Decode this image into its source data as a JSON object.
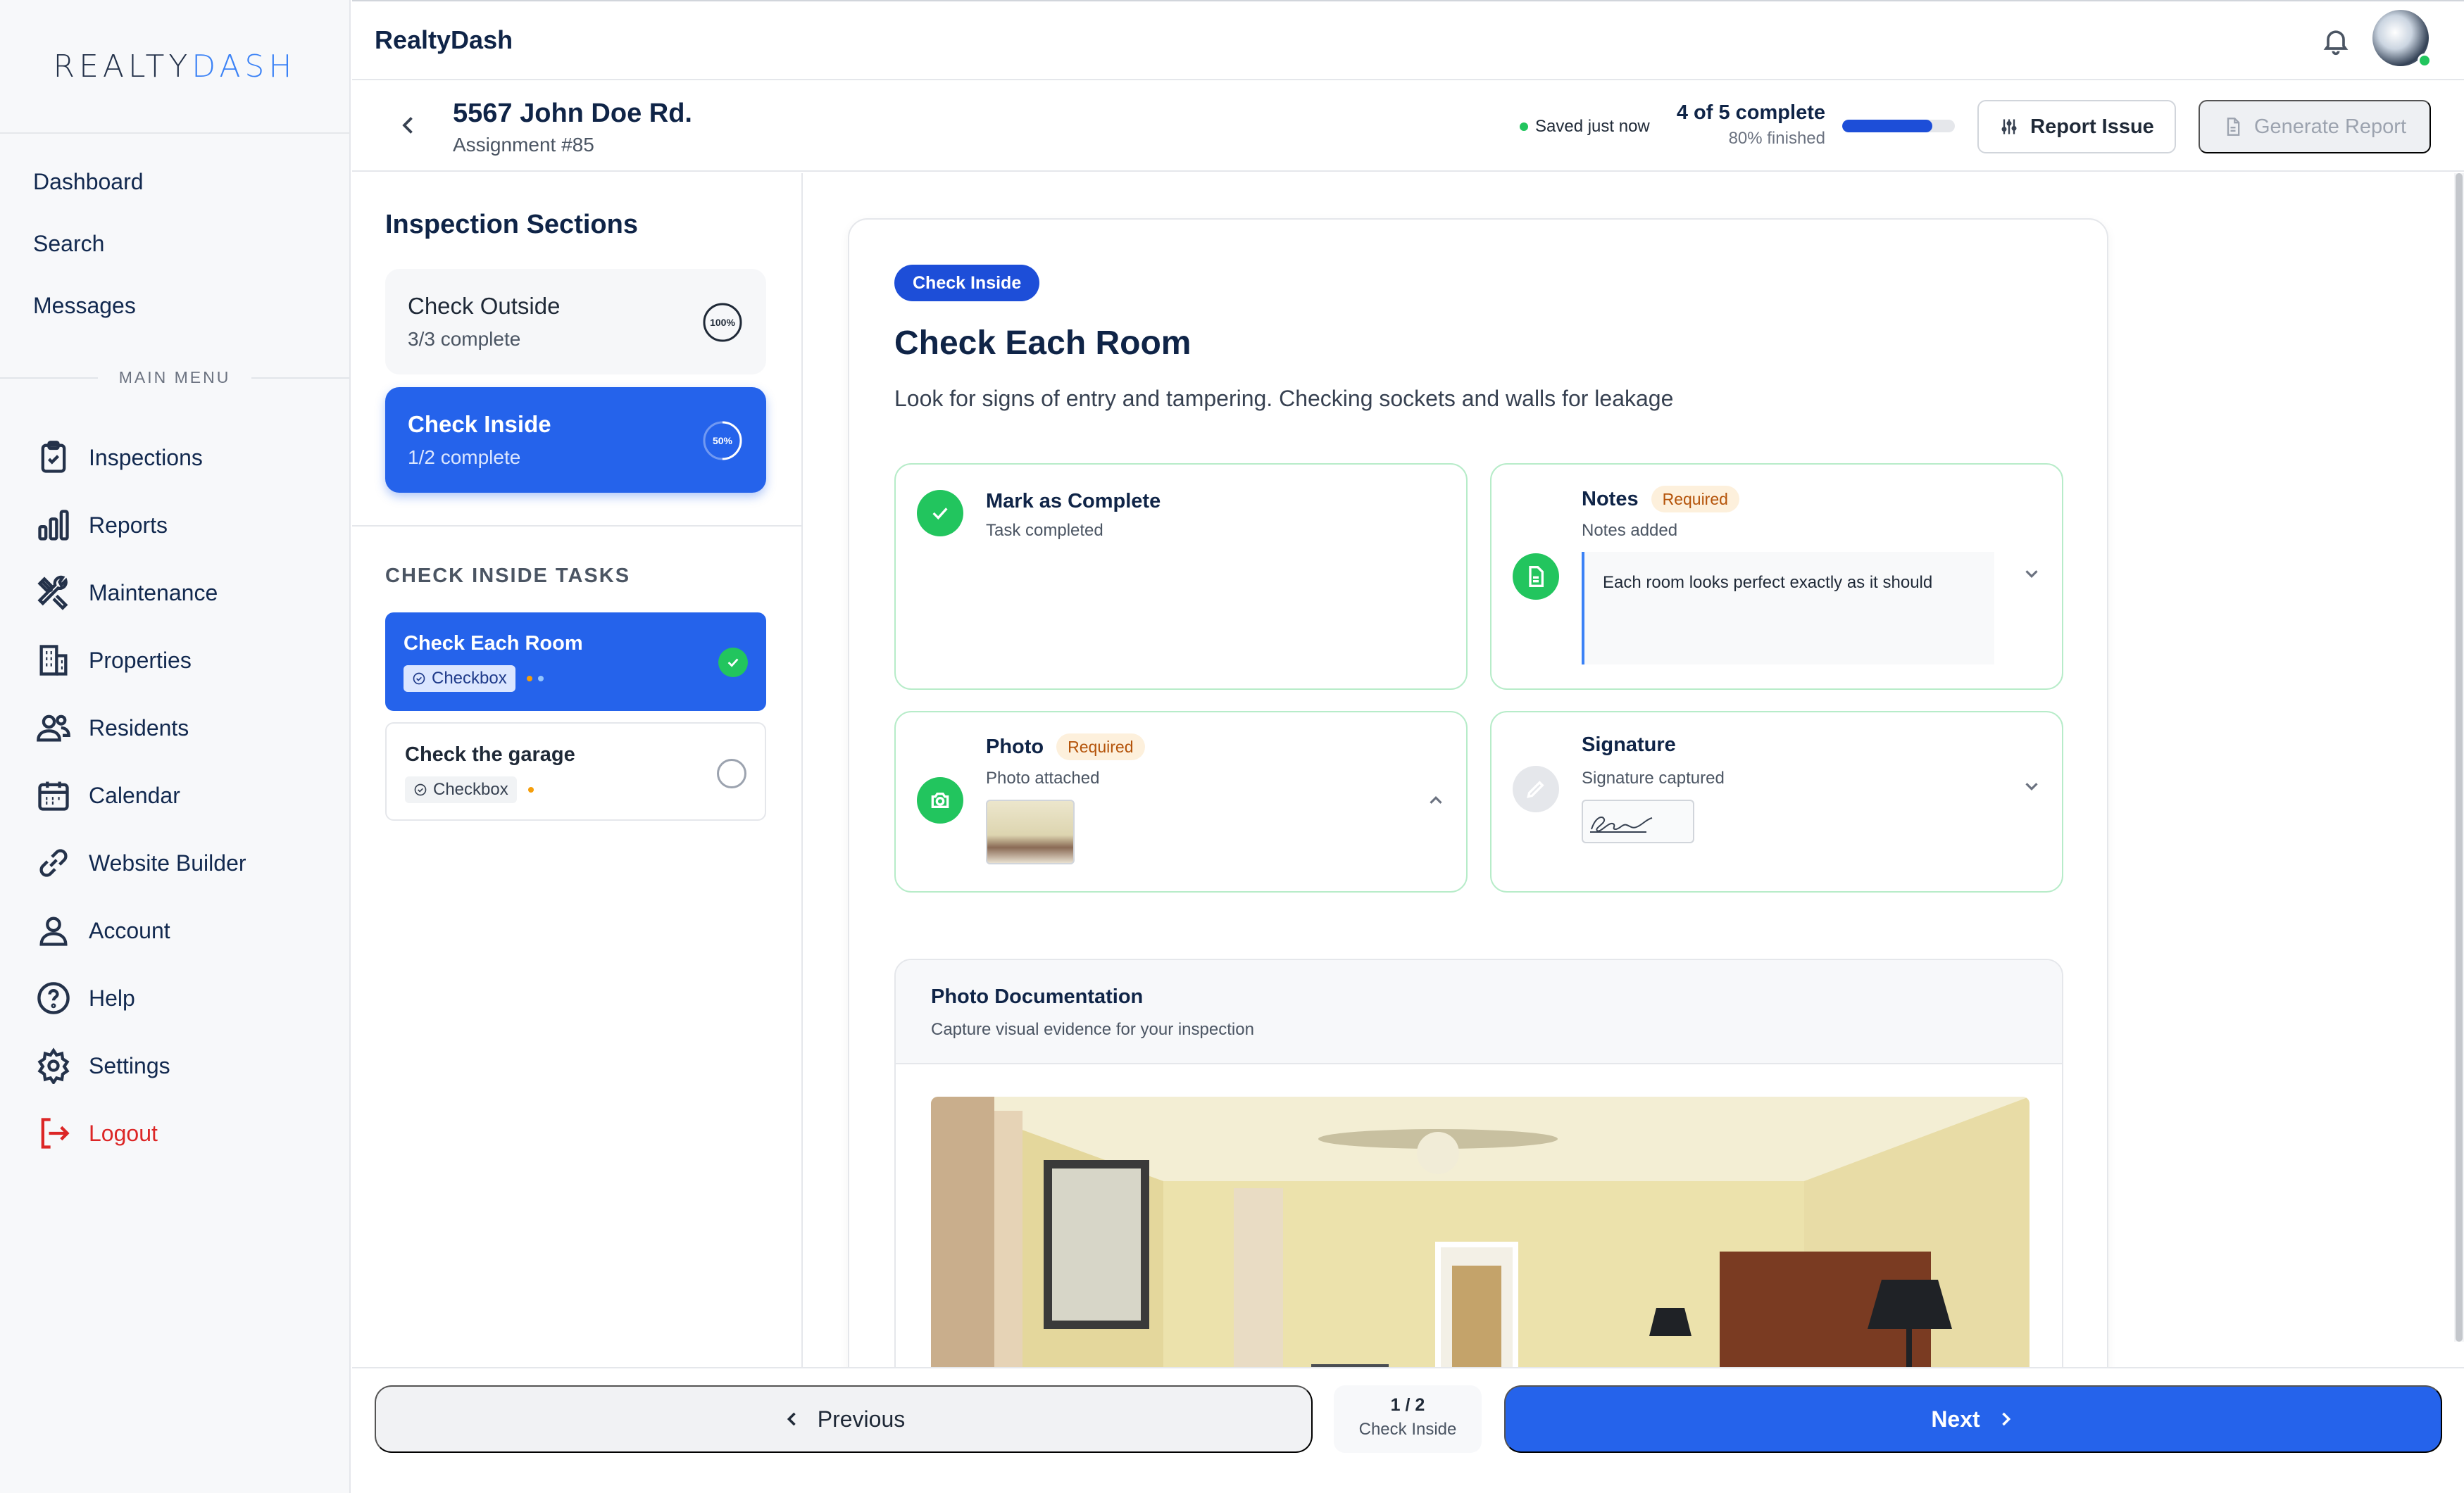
{
  "brand": {
    "logo_left": "REALTY",
    "logo_right": "DASH",
    "app_title": "RealtyDash"
  },
  "sidebar": {
    "top_links": [
      "Dashboard",
      "Search",
      "Messages"
    ],
    "menu_label": "MAIN MENU",
    "menu": [
      {
        "label": "Inspections",
        "icon": "clipboard-icon"
      },
      {
        "label": "Reports",
        "icon": "bar-chart-icon"
      },
      {
        "label": "Maintenance",
        "icon": "tools-icon"
      },
      {
        "label": "Properties",
        "icon": "building-icon"
      },
      {
        "label": "Residents",
        "icon": "users-icon"
      },
      {
        "label": "Calendar",
        "icon": "calendar-icon"
      },
      {
        "label": "Website Builder",
        "icon": "link-icon"
      },
      {
        "label": "Account",
        "icon": "user-icon"
      },
      {
        "label": "Help",
        "icon": "help-icon"
      },
      {
        "label": "Settings",
        "icon": "gear-icon"
      },
      {
        "label": "Logout",
        "icon": "logout-icon"
      }
    ]
  },
  "header": {
    "address": "5567 John Doe Rd.",
    "assignment": "Assignment #85",
    "saved_status": "Saved just now",
    "progress_label": "4 of 5 complete",
    "progress_sub": "80% finished",
    "progress_fraction": 0.8,
    "report_issue": "Report Issue",
    "generate_report": "Generate Report"
  },
  "sections": {
    "title": "Inspection Sections",
    "items": [
      {
        "name": "Check Outside",
        "status": "3/3 complete",
        "percent_label": "100%",
        "fraction": 1.0
      },
      {
        "name": "Check Inside",
        "status": "1/2 complete",
        "percent_label": "50%",
        "fraction": 0.5
      }
    ],
    "tasks_label": "CHECK INSIDE TASKS",
    "tasks": [
      {
        "name": "Check Each Room",
        "type": "Checkbox",
        "done": true
      },
      {
        "name": "Check the garage",
        "type": "Checkbox",
        "done": false
      }
    ]
  },
  "task": {
    "pill": "Check Inside",
    "title": "Check Each Room",
    "description": "Look for signs of entry and tampering. Checking sockets and walls for leakage",
    "complete": {
      "title": "Mark as Complete",
      "sub": "Task completed"
    },
    "notes": {
      "title": "Notes",
      "required": "Required",
      "sub": "Notes added",
      "value": "Each room looks perfect exactly as it should"
    },
    "photo": {
      "title": "Photo",
      "required": "Required",
      "sub": "Photo attached"
    },
    "signature": {
      "title": "Signature",
      "sub": "Signature captured"
    },
    "photo_doc": {
      "title": "Photo Documentation",
      "sub": "Capture visual evidence for your inspection"
    }
  },
  "footer": {
    "previous": "Previous",
    "pager": "1 / 2",
    "pager_sub": "Check Inside",
    "next": "Next"
  },
  "colors": {
    "primary": "#2563eb",
    "success": "#22c55e",
    "danger": "#dc2626",
    "warning_bg": "#fdf0dc",
    "warning_text": "#b45309"
  }
}
